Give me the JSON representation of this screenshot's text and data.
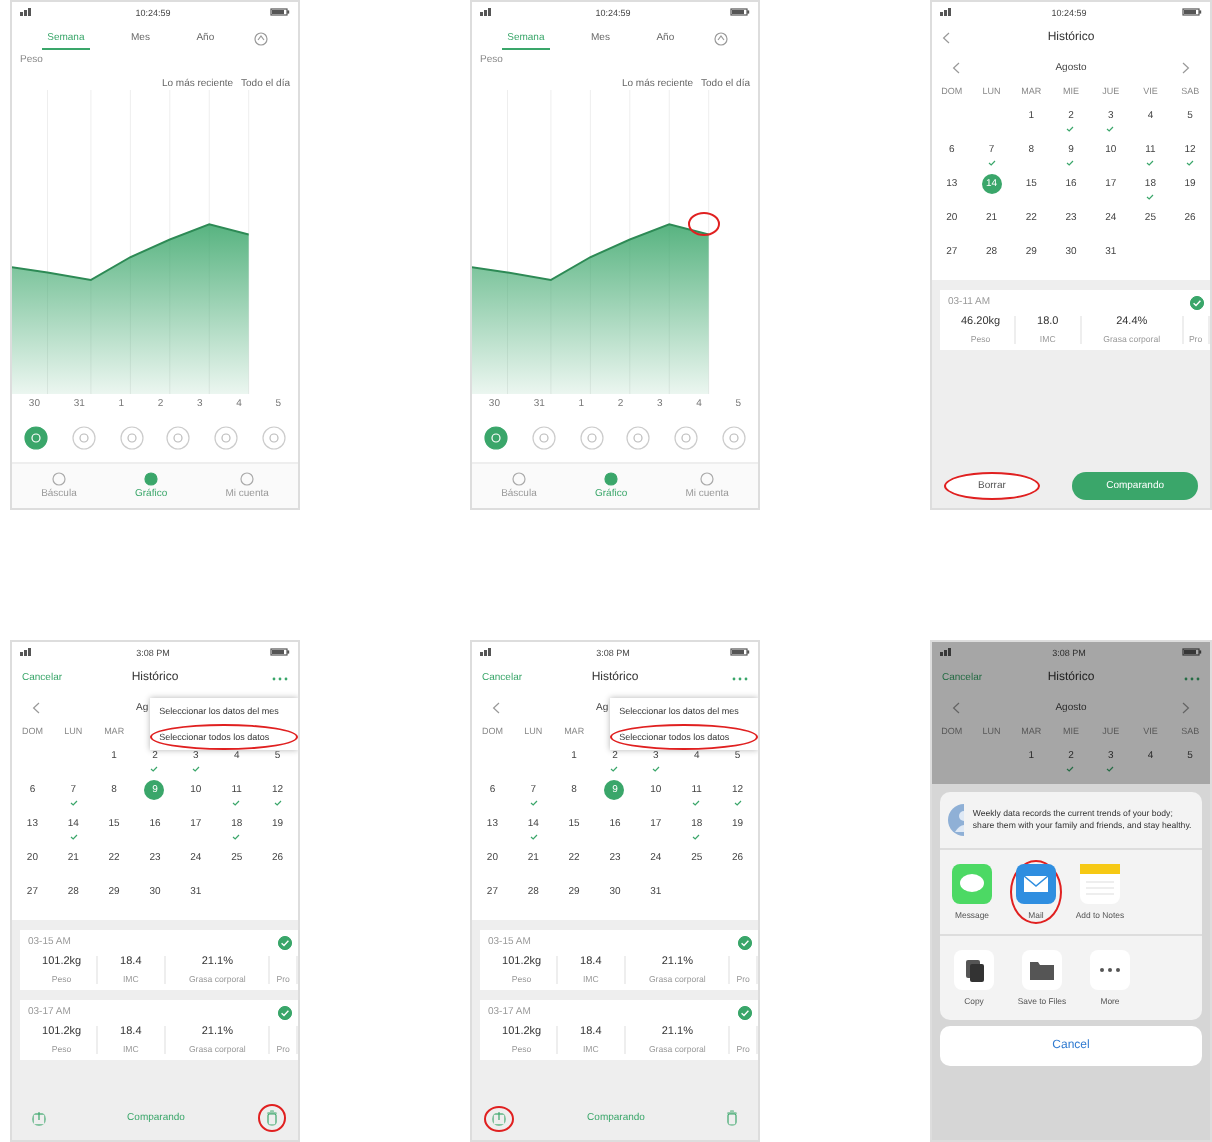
{
  "phones": [
    {
      "kind": "chart",
      "status_time": "10:24:59",
      "tabs": [
        {
          "label": "Semana",
          "selected": true
        },
        {
          "label": "Mes",
          "selected": false
        },
        {
          "label": "Año",
          "selected": false
        }
      ],
      "unit": "Peso",
      "filters": [
        "Lo más reciente",
        "Todo el día"
      ],
      "chart": {
        "end_circled": false
      },
      "x_labels": [
        "30",
        "31",
        "1",
        "2",
        "3",
        "4",
        "5"
      ],
      "metrics": [
        {
          "selected": true
        },
        {
          "selected": false
        },
        {
          "selected": false
        },
        {
          "selected": false
        },
        {
          "selected": false
        },
        {
          "selected": false
        }
      ],
      "nav": [
        {
          "label": "Báscula",
          "selected": false
        },
        {
          "label": "Gráfico",
          "selected": true
        },
        {
          "label": "Mi cuenta",
          "selected": false
        }
      ]
    },
    {
      "kind": "chart",
      "status_time": "10:24:59",
      "tabs": [
        {
          "label": "Semana",
          "selected": true
        },
        {
          "label": "Mes",
          "selected": false
        },
        {
          "label": "Año",
          "selected": false
        }
      ],
      "unit": "Peso",
      "filters": [
        "Lo más reciente",
        "Todo el día"
      ],
      "chart": {
        "end_circled": true
      },
      "x_labels": [
        "30",
        "31",
        "1",
        "2",
        "3",
        "4",
        "5"
      ],
      "metrics": [
        {
          "selected": true
        },
        {
          "selected": false
        },
        {
          "selected": false
        },
        {
          "selected": false
        },
        {
          "selected": false
        },
        {
          "selected": false
        }
      ],
      "nav": [
        {
          "label": "Báscula",
          "selected": false
        },
        {
          "label": "Gráfico",
          "selected": true
        },
        {
          "label": "Mi cuenta",
          "selected": false
        }
      ]
    },
    {
      "kind": "calendar",
      "status_time": "10:24:59",
      "header": {
        "back": true,
        "more": false,
        "title": "Histórico"
      },
      "month": "Agosto",
      "month_arrows": true,
      "weekdays": [
        "DOM",
        "LUN",
        "MAR",
        "MIE",
        "JUE",
        "VIE",
        "SAB"
      ],
      "weeks": [
        {
          "days": [
            {
              "label": "1",
              "selected": false,
              "marked": false
            },
            {
              "label": "2",
              "selected": false,
              "marked": true
            },
            {
              "label": "3",
              "selected": false,
              "marked": true
            },
            {
              "label": "4",
              "selected": false,
              "marked": false
            },
            {
              "label": "5",
              "selected": false,
              "marked": false
            }
          ]
        },
        {
          "days": [
            {
              "label": "6",
              "selected": false,
              "marked": false
            },
            {
              "label": "7",
              "selected": false,
              "marked": true
            },
            {
              "label": "8",
              "selected": false,
              "marked": false
            },
            {
              "label": "9",
              "selected": false,
              "marked": true
            },
            {
              "label": "10",
              "selected": false,
              "marked": false
            },
            {
              "label": "11",
              "selected": false,
              "marked": true
            },
            {
              "label": "12",
              "selected": false,
              "marked": true
            }
          ]
        },
        {
          "days": [
            {
              "label": "13",
              "selected": false,
              "marked": false
            },
            {
              "label": "14",
              "selected": true,
              "marked": false
            },
            {
              "label": "15",
              "selected": false,
              "marked": false
            },
            {
              "label": "16",
              "selected": false,
              "marked": false
            },
            {
              "label": "17",
              "selected": false,
              "marked": false
            },
            {
              "label": "18",
              "selected": false,
              "marked": true
            },
            {
              "label": "19",
              "selected": false,
              "marked": false
            }
          ]
        },
        {
          "days": [
            {
              "label": "20",
              "selected": false,
              "marked": false
            },
            {
              "label": "21",
              "selected": false,
              "marked": false
            },
            {
              "label": "22",
              "selected": false,
              "marked": false
            },
            {
              "label": "23",
              "selected": false,
              "marked": false
            },
            {
              "label": "24",
              "selected": false,
              "marked": false
            },
            {
              "label": "25",
              "selected": false,
              "marked": false
            },
            {
              "label": "26",
              "selected": false,
              "marked": false
            }
          ]
        },
        {
          "days": [
            {
              "label": "27",
              "selected": false,
              "marked": false
            },
            {
              "label": "28",
              "selected": false,
              "marked": false
            },
            {
              "label": "29",
              "selected": false,
              "marked": false
            },
            {
              "label": "30",
              "selected": false,
              "marked": false
            },
            {
              "label": "31",
              "selected": false,
              "marked": false
            }
          ]
        }
      ],
      "records": [
        {
          "time": "03-11 AM",
          "checked": true,
          "cells": [
            {
              "value": "46.20kg",
              "label": "Peso"
            },
            {
              "value": "18.0",
              "label": "IMC"
            },
            {
              "value": "24.4%",
              "label": "Grasa corporal"
            },
            {
              "label": "Pro"
            }
          ]
        }
      ],
      "footer": {
        "kind": "buttons",
        "buttons": [
          {
            "label": "Borrar",
            "primary": false,
            "circled": true
          },
          {
            "label": "Comparando",
            "primary": true,
            "circled": false
          }
        ]
      }
    },
    {
      "kind": "calendar",
      "status_time": "3:08 PM",
      "header": {
        "back": false,
        "more": true,
        "left_text": "Cancelar",
        "title": "Histórico"
      },
      "month": "Ag",
      "month_arrows": false,
      "weekdays": [
        "DOM",
        "LUN",
        "MAR"
      ],
      "menu": [
        {
          "label": "Seleccionar los datos del mes",
          "circled": false
        },
        {
          "label": "Seleccionar todos los datos",
          "circled": true
        }
      ],
      "weeks": [
        {
          "days": [
            {
              "label": "1",
              "selected": false,
              "marked": false
            },
            {
              "label": "2",
              "selected": false,
              "marked": true
            },
            {
              "label": "3",
              "selected": false,
              "marked": true
            },
            {
              "label": "4",
              "selected": false,
              "marked": false
            },
            {
              "label": "5",
              "selected": false,
              "marked": false
            }
          ]
        },
        {
          "days": [
            {
              "label": "6",
              "selected": false,
              "marked": false
            },
            {
              "label": "7",
              "selected": false,
              "marked": true
            },
            {
              "label": "8",
              "selected": false,
              "marked": false
            },
            {
              "label": "9",
              "selected": true,
              "marked": false
            },
            {
              "label": "10",
              "selected": false,
              "marked": false
            },
            {
              "label": "11",
              "selected": false,
              "marked": true
            },
            {
              "label": "12",
              "selected": false,
              "marked": true
            }
          ]
        },
        {
          "days": [
            {
              "label": "13",
              "selected": false,
              "marked": false
            },
            {
              "label": "14",
              "selected": false,
              "marked": true
            },
            {
              "label": "15",
              "selected": false,
              "marked": false
            },
            {
              "label": "16",
              "selected": false,
              "marked": false
            },
            {
              "label": "17",
              "selected": false,
              "marked": false
            },
            {
              "label": "18",
              "selected": false,
              "marked": true
            },
            {
              "label": "19",
              "selected": false,
              "marked": false
            }
          ]
        },
        {
          "days": [
            {
              "label": "20",
              "selected": false,
              "marked": false
            },
            {
              "label": "21",
              "selected": false,
              "marked": false
            },
            {
              "label": "22",
              "selected": false,
              "marked": false
            },
            {
              "label": "23",
              "selected": false,
              "marked": false
            },
            {
              "label": "24",
              "selected": false,
              "marked": false
            },
            {
              "label": "25",
              "selected": false,
              "marked": false
            },
            {
              "label": "26",
              "selected": false,
              "marked": false
            }
          ]
        },
        {
          "days": [
            {
              "label": "27",
              "selected": false,
              "marked": false
            },
            {
              "label": "28",
              "selected": false,
              "marked": false
            },
            {
              "label": "29",
              "selected": false,
              "marked": false
            },
            {
              "label": "30",
              "selected": false,
              "marked": false
            },
            {
              "label": "31",
              "selected": false,
              "marked": false
            }
          ]
        }
      ],
      "records": [
        {
          "time": "03-15 AM",
          "checked": true,
          "cells": [
            {
              "value": "101.2kg",
              "label": "Peso"
            },
            {
              "value": "18.4",
              "label": "IMC"
            },
            {
              "value": "21.1%",
              "label": "Grasa corporal"
            },
            {
              "label": "Pro"
            }
          ]
        },
        {
          "time": "03-17 AM",
          "checked": true,
          "cells": [
            {
              "value": "101.2kg",
              "label": "Peso"
            },
            {
              "value": "18.4",
              "label": "IMC"
            },
            {
              "value": "21.1%",
              "label": "Grasa corporal"
            },
            {
              "label": "Pro"
            }
          ]
        }
      ],
      "footer": {
        "kind": "toolbar",
        "text": "Comparando",
        "export_circled": false,
        "trash_circled": true
      }
    },
    {
      "kind": "calendar",
      "status_time": "3:08 PM",
      "header": {
        "back": false,
        "more": true,
        "left_text": "Cancelar",
        "title": "Histórico"
      },
      "month": "Ag",
      "month_arrows": false,
      "weekdays": [
        "DOM",
        "LUN",
        "MAR"
      ],
      "menu": [
        {
          "label": "Seleccionar los datos del mes",
          "circled": false
        },
        {
          "label": "Seleccionar todos los datos",
          "circled": true
        }
      ],
      "weeks": [
        {
          "days": [
            {
              "label": "1",
              "selected": false,
              "marked": false
            },
            {
              "label": "2",
              "selected": false,
              "marked": true
            },
            {
              "label": "3",
              "selected": false,
              "marked": true
            },
            {
              "label": "4",
              "selected": false,
              "marked": false
            },
            {
              "label": "5",
              "selected": false,
              "marked": false
            }
          ]
        },
        {
          "days": [
            {
              "label": "6",
              "selected": false,
              "marked": false
            },
            {
              "label": "7",
              "selected": false,
              "marked": true
            },
            {
              "label": "8",
              "selected": false,
              "marked": false
            },
            {
              "label": "9",
              "selected": true,
              "marked": false
            },
            {
              "label": "10",
              "selected": false,
              "marked": false
            },
            {
              "label": "11",
              "selected": false,
              "marked": true
            },
            {
              "label": "12",
              "selected": false,
              "marked": true
            }
          ]
        },
        {
          "days": [
            {
              "label": "13",
              "selected": false,
              "marked": false
            },
            {
              "label": "14",
              "selected": false,
              "marked": true
            },
            {
              "label": "15",
              "selected": false,
              "marked": false
            },
            {
              "label": "16",
              "selected": false,
              "marked": false
            },
            {
              "label": "17",
              "selected": false,
              "marked": false
            },
            {
              "label": "18",
              "selected": false,
              "marked": true
            },
            {
              "label": "19",
              "selected": false,
              "marked": false
            }
          ]
        },
        {
          "days": [
            {
              "label": "20",
              "selected": false,
              "marked": false
            },
            {
              "label": "21",
              "selected": false,
              "marked": false
            },
            {
              "label": "22",
              "selected": false,
              "marked": false
            },
            {
              "label": "23",
              "selected": false,
              "marked": false
            },
            {
              "label": "24",
              "selected": false,
              "marked": false
            },
            {
              "label": "25",
              "selected": false,
              "marked": false
            },
            {
              "label": "26",
              "selected": false,
              "marked": false
            }
          ]
        },
        {
          "days": [
            {
              "label": "27",
              "selected": false,
              "marked": false
            },
            {
              "label": "28",
              "selected": false,
              "marked": false
            },
            {
              "label": "29",
              "selected": false,
              "marked": false
            },
            {
              "label": "30",
              "selected": false,
              "marked": false
            },
            {
              "label": "31",
              "selected": false,
              "marked": false
            }
          ]
        }
      ],
      "records": [
        {
          "time": "03-15 AM",
          "checked": true,
          "cells": [
            {
              "value": "101.2kg",
              "label": "Peso"
            },
            {
              "value": "18.4",
              "label": "IMC"
            },
            {
              "value": "21.1%",
              "label": "Grasa corporal"
            },
            {
              "label": "Pro"
            }
          ]
        },
        {
          "time": "03-17 AM",
          "checked": true,
          "cells": [
            {
              "value": "101.2kg",
              "label": "Peso"
            },
            {
              "value": "18.4",
              "label": "IMC"
            },
            {
              "value": "21.1%",
              "label": "Grasa corporal"
            },
            {
              "label": "Pro"
            }
          ]
        }
      ],
      "footer": {
        "kind": "toolbar",
        "text": "Comparando",
        "export_circled": true,
        "trash_circled": false
      }
    },
    {
      "kind": "share",
      "status_time": "3:08 PM",
      "header": {
        "back": false,
        "more": true,
        "left_text": "Cancelar",
        "title": "Histórico"
      },
      "month": "Agosto",
      "month_arrows": true,
      "weekdays": [
        "DOM",
        "LUN",
        "MAR",
        "MIE",
        "JUE",
        "VIE",
        "SAB"
      ],
      "weeks": [
        {
          "days": [
            {
              "label": "1",
              "selected": false,
              "marked": false
            },
            {
              "label": "2",
              "selected": false,
              "marked": true
            },
            {
              "label": "3",
              "selected": false,
              "marked": true
            },
            {
              "label": "4",
              "selected": false,
              "marked": false
            },
            {
              "label": "5",
              "selected": false,
              "marked": false
            }
          ]
        }
      ],
      "message": "Weekly data records the current trends of your body; share them with your family and friends, and stay healthy.",
      "apps": [
        {
          "label": "Message",
          "kind": "messages",
          "circled": false
        },
        {
          "label": "Mail",
          "kind": "mail",
          "circled": true
        },
        {
          "label": "Add to Notes",
          "kind": "notes",
          "circled": false
        }
      ],
      "actions": [
        {
          "label": "Copy",
          "kind": "copy"
        },
        {
          "label": "Save to Files",
          "kind": "folder"
        },
        {
          "label": "More",
          "kind": "more"
        }
      ],
      "cancel": "Cancel"
    }
  ]
}
